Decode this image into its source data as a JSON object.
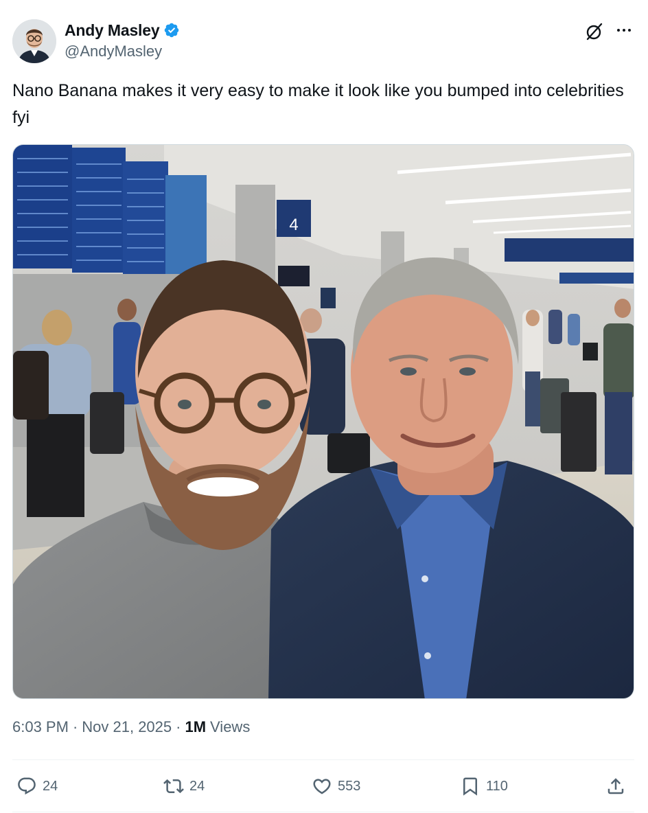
{
  "author": {
    "display_name": "Andy Masley",
    "handle": "@AndyMasley",
    "verified": true,
    "verified_color": "#1d9bf0"
  },
  "icons": {
    "verified": "verified-badge-icon",
    "grok": "grok-icon",
    "more": "more-icon",
    "reply": "reply-icon",
    "retweet": "retweet-icon",
    "like": "like-icon",
    "bookmark": "bookmark-icon",
    "share": "share-icon"
  },
  "tweet": {
    "text": "Nano Banana makes it very easy to make it look like you bumped into celebrities fyi",
    "image_alt": "Selfie of two men in an airport terminal",
    "sign_text": "4"
  },
  "meta": {
    "time": "6:03 PM",
    "separator_1": "·",
    "date": "Nov 21, 2025",
    "separator_2": "·",
    "views_count": "1M",
    "views_label": "Views"
  },
  "actions": {
    "replies": "24",
    "retweets": "24",
    "likes": "553",
    "bookmarks": "110"
  },
  "colors": {
    "text_primary": "#0f1419",
    "text_secondary": "#536471",
    "accent": "#1d9bf0"
  }
}
